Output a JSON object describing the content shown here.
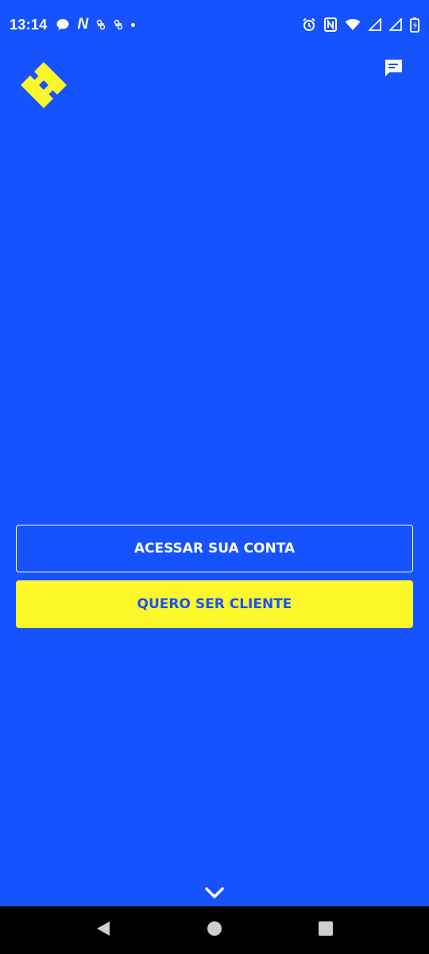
{
  "status_bar": {
    "time": "13:14",
    "left_icons": [
      "chat-bubble-icon",
      "n-app-icon",
      "notification-icon",
      "notification-icon",
      "dot-icon"
    ],
    "right_icons": [
      "alarm-icon",
      "nfc-icon",
      "wifi-icon",
      "signal-icon",
      "signal-icon",
      "battery-icon"
    ],
    "n_glyph": "N"
  },
  "header": {
    "logo": "banco-do-brasil-logo",
    "chat_icon": "chat-icon"
  },
  "actions": {
    "access_account_label": "ACESSAR SUA CONTA",
    "become_client_label": "QUERO SER CLIENTE"
  },
  "colors": {
    "background": "#1752FF",
    "accent": "#FCF729",
    "text_light": "#FFFFFF"
  },
  "footer": {
    "expand_icon": "chevron-down-icon"
  },
  "nav_bar": {
    "items": [
      "back-icon",
      "home-icon",
      "recents-icon"
    ]
  }
}
